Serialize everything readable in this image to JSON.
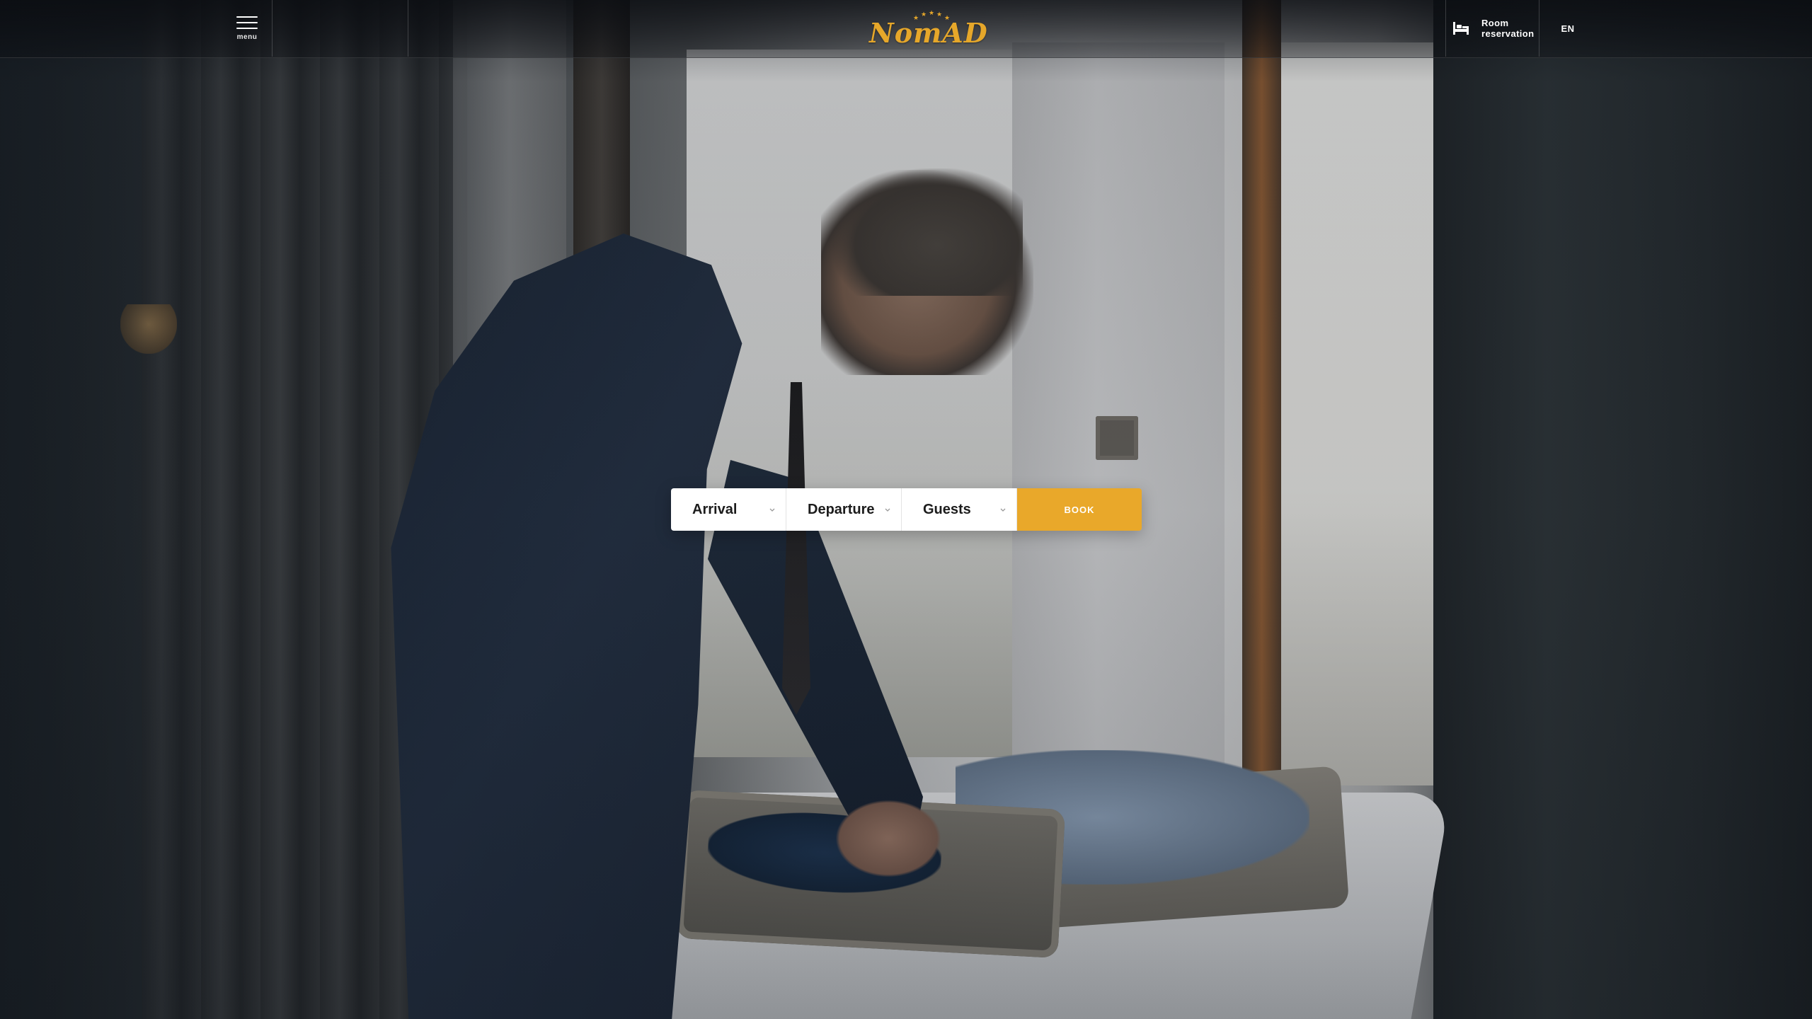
{
  "header": {
    "menu_label": "menu",
    "logo_text": "NomAD",
    "reservation_line1": "Room",
    "reservation_line2": "reservation",
    "language": "EN"
  },
  "booking": {
    "arrival_label": "Arrival",
    "departure_label": "Departure",
    "guests_label": "Guests",
    "book_label": "BOOK"
  },
  "colors": {
    "accent": "#e9a82a",
    "logo": "#e6a72a",
    "header_bg": "#0a0c10"
  },
  "icons": {
    "menu": "hamburger-menu-icon",
    "reservation": "bed-icon",
    "dropdown": "chevron-down-icon",
    "logo_decoration": "stars-icon"
  }
}
